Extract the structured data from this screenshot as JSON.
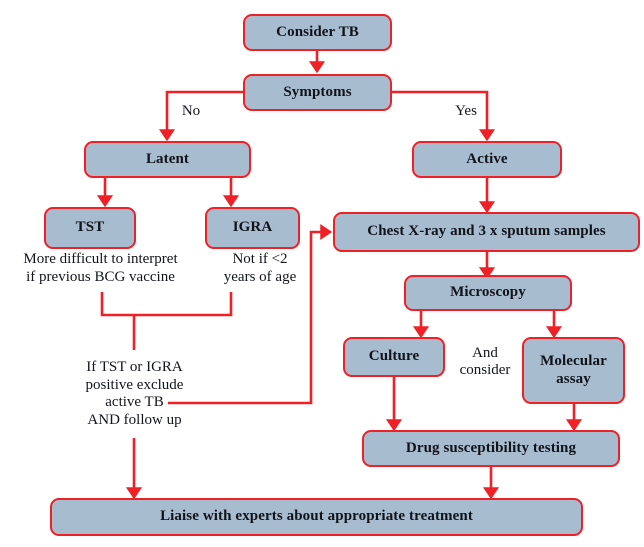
{
  "diagram": {
    "title": "Tuberculosis diagnostic pathway flowchart",
    "colors": {
      "node_fill": "#a8bcd0",
      "node_border": "#ef2026",
      "connector": "#ef2026",
      "text": "#13151c",
      "background": "#ffffff"
    },
    "nodes": [
      {
        "id": "consider_tb",
        "label": "Consider TB"
      },
      {
        "id": "symptoms",
        "label": "Symptoms"
      },
      {
        "id": "latent",
        "label": "Latent"
      },
      {
        "id": "active",
        "label": "Active"
      },
      {
        "id": "tst",
        "label": "TST"
      },
      {
        "id": "igra",
        "label": "IGRA"
      },
      {
        "id": "chest_xray",
        "label": "Chest X-ray and 3 x sputum samples"
      },
      {
        "id": "microscopy",
        "label": "Microscopy"
      },
      {
        "id": "culture",
        "label": "Culture"
      },
      {
        "id": "molecular_assay",
        "label": "Molecular\nassay"
      },
      {
        "id": "drug_susceptibility",
        "label": "Drug susceptibility testing"
      },
      {
        "id": "liaise",
        "label": "Liaise with experts about appropriate treatment"
      }
    ],
    "edge_labels": [
      {
        "id": "no",
        "label": "No"
      },
      {
        "id": "yes",
        "label": "Yes"
      },
      {
        "id": "and_consider",
        "label": "And\nconsider"
      }
    ],
    "notes": [
      {
        "id": "tst_note",
        "label": "More difficult to interpret\nif previous BCG vaccine"
      },
      {
        "id": "igra_note",
        "label": "Not if <2\nyears of age"
      },
      {
        "id": "positive_note",
        "label": "If TST or IGRA\npositive exclude\nactive TB\nAND follow up"
      }
    ]
  }
}
